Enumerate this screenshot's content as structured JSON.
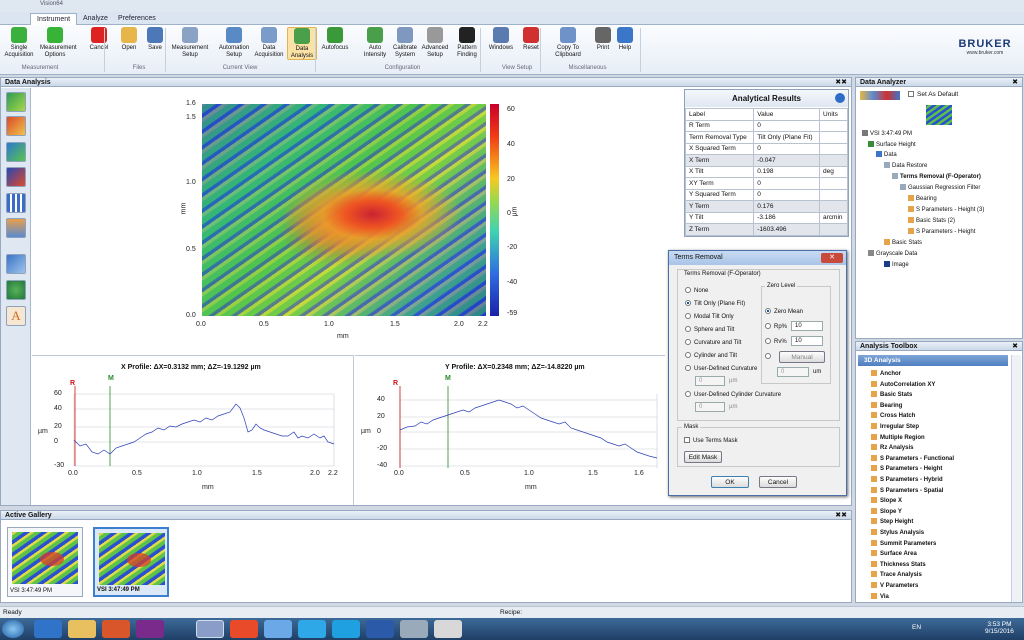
{
  "window": {
    "title": "Vision64"
  },
  "ribbon": {
    "tabs": [
      "Instrument",
      "Analyze",
      "Preferences"
    ],
    "buttons": [
      {
        "label": "Single\nAcquisition",
        "color": "#3cb03c"
      },
      {
        "label": "Measurement\nOptions",
        "color": "#37b337"
      },
      {
        "label": "Cancel",
        "color": "#d22"
      },
      {
        "label": "Open",
        "color": "#e7b64a"
      },
      {
        "label": "Save",
        "color": "#4d78b8"
      },
      {
        "label": "Measurement\nSetup",
        "color": "#8aa2c4"
      },
      {
        "label": "Automation\nSetup",
        "color": "#5a8ac6"
      },
      {
        "label": "Data\nAcquisition",
        "color": "#7b9cc8"
      },
      {
        "label": "Data\nAnalysis",
        "color": "#4aa04a"
      },
      {
        "label": "Autofocus",
        "color": "#3a9a3a"
      },
      {
        "label": "Auto\nIntensity",
        "color": "#4aa04a"
      },
      {
        "label": "Calibrate\nSystem",
        "color": "#7e98c0"
      },
      {
        "label": "Advanced\nSetup",
        "color": "#999"
      },
      {
        "label": "Pattern\nFinding",
        "color": "#222"
      },
      {
        "label": "Windows",
        "color": "#5a7bb0"
      },
      {
        "label": "Reset",
        "color": "#d03030"
      },
      {
        "label": "Copy To\nClipboard",
        "color": "#6f93c8"
      },
      {
        "label": "Print",
        "color": "#666"
      },
      {
        "label": "Help",
        "color": "#3c76c8"
      }
    ],
    "groups": [
      "Measurement",
      "Files",
      "Current View",
      "Configuration",
      "View Setup",
      "Miscellaneous"
    ],
    "brand": "BRUKER",
    "brand_url": "www.bruker.com"
  },
  "data_analysis": {
    "title": "Data Analysis",
    "heatmap": {
      "y_ticks": [
        "1.6",
        "1.5",
        "1.0",
        "0.5",
        "0.0"
      ],
      "x_ticks": [
        "0.0",
        "0.5",
        "1.0",
        "1.5",
        "2.0",
        "2.2"
      ],
      "xlabel": "mm",
      "ylabel": "mm",
      "cbar_ticks": [
        "60",
        "40",
        "20",
        "0",
        "-20",
        "-40",
        "-59"
      ],
      "cbar_label": "µm"
    },
    "x_profile": {
      "title": "X Profile: ΔX=0.3132 mm; ΔZ=-19.1292 µm",
      "r": "R",
      "m": "M",
      "ylabel": "µm",
      "xlabel": "mm",
      "y_ticks": [
        "60",
        "40",
        "20",
        "0",
        "-30"
      ],
      "x_ticks": [
        "0.0",
        "0.5",
        "1.0",
        "1.5",
        "2.0",
        "2.2"
      ]
    },
    "y_profile": {
      "title": "Y Profile: ΔX=0.2348 mm; ΔZ=-14.8220 µm",
      "r": "R",
      "m": "M",
      "ylabel": "µm",
      "xlabel": "mm",
      "y_ticks": [
        "40",
        "20",
        "0",
        "-20",
        "-40"
      ],
      "x_ticks": [
        "0.0",
        "0.5",
        "1.0",
        "1.5",
        "1.6"
      ]
    }
  },
  "analytical_results": {
    "title": "Analytical Results",
    "headers": [
      "Label",
      "Value",
      "Units"
    ],
    "rows": [
      [
        "R Term",
        "0",
        ""
      ],
      [
        "Term Removal Type",
        "Tilt Only (Plane Fit)",
        ""
      ],
      [
        "X Squared Term",
        "0",
        ""
      ],
      [
        "X Term",
        "-0.047",
        ""
      ],
      [
        "X Tilt",
        "0.198",
        "deg"
      ],
      [
        "XY Term",
        "0",
        ""
      ],
      [
        "Y Squared Term",
        "0",
        ""
      ],
      [
        "Y Term",
        "0.176",
        ""
      ],
      [
        "Y Tilt",
        "-3.186",
        "arcmin"
      ],
      [
        "Z Term",
        "-1603.496",
        ""
      ]
    ]
  },
  "dialog": {
    "title": "Terms Removal",
    "group": "Terms Removal (F-Operator)",
    "options": [
      "None",
      "Tilt Only (Plane Fit)",
      "Modal Tilt Only",
      "Sphere and Tilt",
      "Curvature and Tilt",
      "Cylinder and Tilt",
      "User-Defined Curvature",
      "User-Defined Cylinder Curvature"
    ],
    "udc_value": "0",
    "udc_unit": "µm",
    "udcc_value": "0",
    "udcc_unit": "µm",
    "zero_level": "Zero Level",
    "zero_mean": "Zero Mean",
    "rp_label": "Rp%",
    "rp_value": "10",
    "rv_label": "Rv%",
    "rv_value": "10",
    "manual": "Manual",
    "manual_value": "0",
    "manual_unit": "um",
    "mask": "Mask",
    "use_mask": "Use Terms Mask",
    "edit_mask": "Edit Mask",
    "ok": "OK",
    "cancel": "Cancel"
  },
  "data_analyzer": {
    "title": "Data Analyzer",
    "set_default": "Set As Default",
    "tree": [
      "VSI 3:47:49 PM",
      "Surface Height",
      "Data",
      "Data Restore",
      "Terms Removal (F-Operator)",
      "Gaussian Regression Filter",
      "Bearing",
      "S Parameters - Height (3)",
      "Basic Stats (2)",
      "S Parameters - Height",
      "Basic Stats",
      "Grayscale Data",
      "Image"
    ]
  },
  "toolbox": {
    "title": "Analysis Toolbox",
    "category": "3D Analysis",
    "items": [
      "Anchor",
      "AutoCorrelation XY",
      "Basic Stats",
      "Bearing",
      "Cross Hatch",
      "Irregular Step",
      "Multiple Region",
      "Rz Analysis",
      "S Parameters - Functional",
      "S Parameters - Height",
      "S Parameters - Hybrid",
      "S Parameters - Spatial",
      "Slope X",
      "Slope Y",
      "Step Height",
      "Stylus Analysis",
      "Summit Parameters",
      "Surface Area",
      "Thickness Stats",
      "Trace Analysis",
      "V Parameters",
      "Via"
    ]
  },
  "gallery": {
    "title": "Active Gallery",
    "items": [
      "VSI 3:47:49 PM",
      "VSI 3:47:49 PM"
    ]
  },
  "status": {
    "left": "Ready",
    "recipe": "Recipe:"
  },
  "taskbar": {
    "lang": "EN",
    "time": "3:53 PM",
    "date": "9/15/2016"
  }
}
